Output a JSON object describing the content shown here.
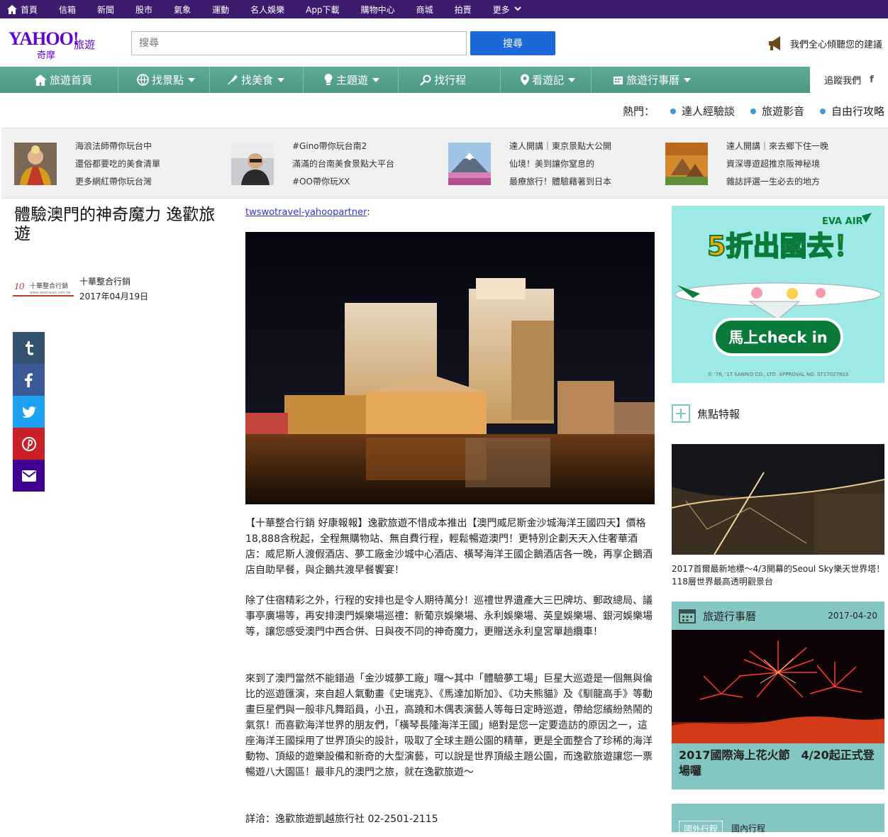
{
  "topbar": {
    "items": [
      "首頁",
      "信箱",
      "新聞",
      "股市",
      "氣象",
      "運動",
      "名人娛樂",
      "App下載",
      "購物中心",
      "商城",
      "拍賣",
      "更多"
    ]
  },
  "header": {
    "logo_text": "YAHOO!",
    "logo_sub": "奇摩",
    "logo_section": "旅遊",
    "search_placeholder": "搜尋",
    "search_button": "搜尋",
    "feedback": "我們全心傾聽您的建議"
  },
  "nav": {
    "items": [
      "旅遊首頁",
      "找景點",
      "找美食",
      "主題遊",
      "找行程",
      "看遊記",
      "旅遊行事曆"
    ],
    "follow": "追蹤我們",
    "follow_icon": "f"
  },
  "hot": {
    "label": "熱門：",
    "items": [
      "達人經驗談",
      "旅遊影音",
      "自由行攻略"
    ]
  },
  "strip": {
    "blocks": [
      {
        "lines": [
          "海浪法師帶你玩台中",
          "還俗都要吃的美食清單",
          "更多網紅帶你玩台灣"
        ]
      },
      {
        "lines": [
          "#Gino帶你玩台南2",
          "滿滿的台南美食景點大平台",
          "#OO帶你玩XX"
        ]
      },
      {
        "lines": [
          "達人開講｜東京景點大公開",
          "仙境！美到讓你窒息的",
          "最療旅行！體驗藉著到日本"
        ]
      },
      {
        "lines": [
          "達人開講｜來去鄉下住一晚",
          "資深導遊超推京阪神秘境",
          "雜誌評選一生必去的地方"
        ]
      }
    ]
  },
  "article": {
    "title": "體驗澳門的神奇魔力 逸歡旅遊",
    "author_logo_text": "十華整合行銷",
    "author_logo_url": "www.swotravel.com.tw",
    "author": "十華整合行銷",
    "date": "2017年04月19日",
    "partner": "twswotravel-yahoopartner",
    "partner_colon": ":",
    "paragraphs": [
      "【十華整合行銷 好康報報】逸歡旅遊不惜成本推出【澳門威尼斯金沙城海洋王國四天】價格18,888含稅起，全程無購物站、無自費行程，輕鬆暢遊澳門！更特別企劃天天入住奢華酒店：威尼斯人渡假酒店、夢工廠金沙城中心酒店、橫琴海洋王國企鵝酒店各一晚，再享企鵝酒店自助早餐，與企鵝共渡早餐饗宴！",
      "除了住宿精彩之外，行程的安排也是令人期待萬分！巡禮世界遺產大三巴牌坊、郵政總局、議事亭廣場等，再安排澳門娛樂場巡禮：新葡京娛樂場、永利娛樂場、英皇娛樂場、銀河娛樂場等，讓您感受澳門中西合併、日與夜不同的神奇魔力，更贈送永利皇宮單趟纜車！",
      "來到了澳門當然不能錯過「金沙城夢工廠」囉～其中「體驗夢工場」巨星大巡遊是一個無與倫比的巡遊匯演，來自超人氣動畫《史瑞克》、《馬達加斯加》、《功夫熊貓》及《馴龍高手》等動畫巨星們與一般非凡舞蹈員，小丑，高蹺和木偶表演藝人等每日定時巡遊，帶給您繽紛熱鬧的氣氛！而喜歡海洋世界的朋友們，「橫琴長隆海洋王國」絕對是您一定要造訪的原因之一，這座海洋王國採用了世界頂尖的設計，吸取了全球主題公園的精華，更是全面整合了珍稀的海洋動物、頂級的遊樂設備和新奇的大型演藝，可以說是世界頂級主題公園，而逸歡旅遊讓您一票暢遊八大園區！最非凡的澳門之旅，就在逸歡旅遊～",
      "詳洽：逸歡旅遊凱越旅行社 02-2501-2115"
    ]
  },
  "share": {
    "icons": [
      "tumblr-icon",
      "facebook-icon",
      "twitter-icon",
      "pinterest-icon",
      "mail-icon"
    ],
    "colors": [
      "#34526f",
      "#3b5998",
      "#1da1f2",
      "#cb2027",
      "#400090"
    ]
  },
  "ad": {
    "brand": "EVA AIR",
    "headline": "5折出國去！",
    "cta": "馬上check in",
    "copyright": "© '76, '17 SANRIO CO., LTD. APPROVAL NO. ST17027803"
  },
  "sidebar": {
    "focus_title": "焦點特報",
    "focus_caption": "2017首爾最新地標～4/3開幕的Seoul Sky樂天世界塔！118層世界最高透明觀景台",
    "calendar_title": "旅遊行事曆",
    "calendar_date": "2017-04-20",
    "calendar_caption": "2017國際海上花火節　4/20起正式登場囉",
    "tabs": [
      "國外行程",
      "國內行程"
    ]
  },
  "colors": {
    "topbar": "#3c1a6e",
    "brand": "#5f01d1",
    "nav": "#4b9783",
    "search_button": "#1b68d9",
    "hot_dot": "#3c9ad8",
    "calendar": "#84c7c2"
  }
}
